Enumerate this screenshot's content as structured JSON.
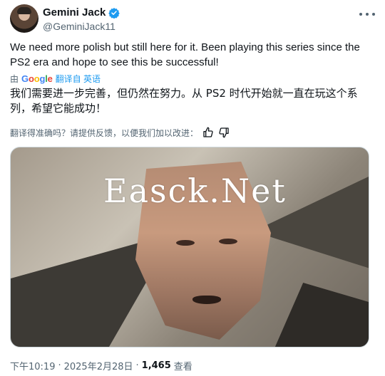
{
  "author": {
    "name": "Gemini Jack",
    "handle": "@GeminiJack11",
    "verified": true
  },
  "tweet": {
    "text": "We need more polish but still here for it. Been playing this series since the PS2 era and hope to see this be successful!"
  },
  "translation": {
    "by_label": "由",
    "provider": "Google",
    "from_label": "翻译自 英语",
    "text": "我们需要进一步完善，但仍然在努力。从 PS2 时代开始就一直在玩这个系列，希望它能成功！",
    "feedback_prompt": "翻译得准确吗？请提供反馈，以便我们加以改进："
  },
  "media": {
    "watermark": "Easck.Net"
  },
  "meta": {
    "time": "下午10:19",
    "date": "2025年2月28日",
    "separator": "·",
    "views_count": "1,465",
    "views_label": "查看"
  },
  "colors": {
    "text_primary": "#0f1419",
    "text_secondary": "#536471",
    "accent": "#1d9bf0"
  },
  "icons": {
    "verified": "verified-badge-icon",
    "more": "more-icon",
    "thumbs_up": "thumbs-up-icon",
    "thumbs_down": "thumbs-down-icon"
  }
}
